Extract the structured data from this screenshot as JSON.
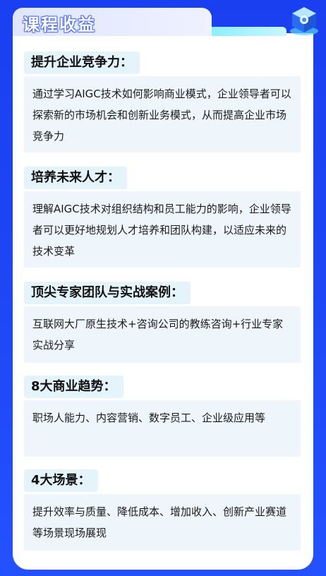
{
  "header": {
    "title": "课程收益",
    "icon": "cube-icon"
  },
  "sections": [
    {
      "title": "提升企业竞争力：",
      "body": "通过学习AIGC技术如何影响商业模式，企业领导者可以探索新的市场机会和创新业务模式，从而提高企业市场竞争力"
    },
    {
      "title": "培养未来人才：",
      "body": "理解AIGC技术对组织结构和员工能力的影响，企业领导者可以更好地规划人才培养和团队构建，以适应未来的技术变革"
    },
    {
      "title": "顶尖专家团队与实战案例：",
      "body": "互联网大厂原生技术+咨询公司的教练咨询+行业专家实战分享"
    },
    {
      "title": "8大商业趋势：",
      "body": "职场人能力、内容营销、数字员工、企业级应用等"
    },
    {
      "title": "4大场景：",
      "body": "提升效率与质量、降低成本、增加收入、创新产业赛道等场景现场展现"
    }
  ]
}
